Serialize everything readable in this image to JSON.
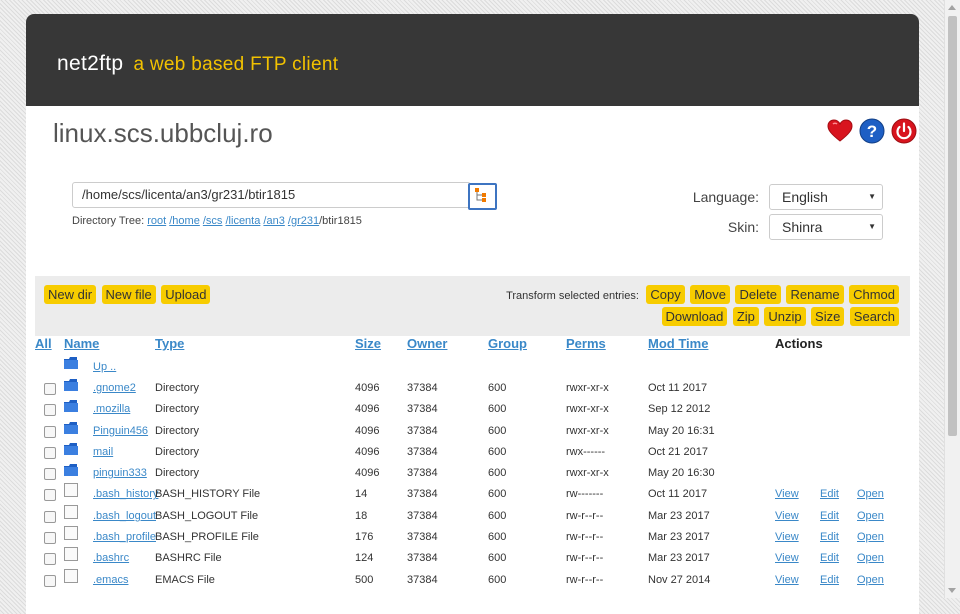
{
  "brand": {
    "name": "net2ftp",
    "tagline": "a web based FTP client"
  },
  "host": "linux.scs.ubbcluj.ro",
  "header_icons": [
    "heart-icon",
    "help-icon",
    "power-icon"
  ],
  "path": {
    "value": "/home/scs/licenta/an3/gr231/btir1815"
  },
  "dirtree": {
    "label": "Directory Tree:",
    "crumbs": [
      "root",
      "/home",
      "/scs",
      "/licenta",
      "/an3",
      "/gr231"
    ],
    "current": "/btir1815"
  },
  "settings": {
    "language_label": "Language:",
    "language_value": "English",
    "skin_label": "Skin:",
    "skin_value": "Shinra"
  },
  "toolbar": {
    "left": [
      "New dir",
      "New file",
      "Upload"
    ],
    "transform_label": "Transform selected entries:",
    "right_row1": [
      "Copy",
      "Move",
      "Delete",
      "Rename",
      "Chmod"
    ],
    "right_row2": [
      "Download",
      "Zip",
      "Unzip",
      "Size",
      "Search"
    ]
  },
  "columns": {
    "all": "All",
    "name": "Name",
    "type": "Type",
    "size": "Size",
    "owner": "Owner",
    "group": "Group",
    "perms": "Perms",
    "mtime": "Mod Time",
    "actions": "Actions"
  },
  "up_label": "Up ..",
  "actions": {
    "view": "View",
    "edit": "Edit",
    "open": "Open"
  },
  "files": [
    {
      "name": ".gnome2",
      "type": "Directory",
      "size": "4096",
      "owner": "37384",
      "group": "600",
      "perms": "rwxr-xr-x",
      "mtime": "Oct 11 2017",
      "kind": "folder"
    },
    {
      "name": ".mozilla",
      "type": "Directory",
      "size": "4096",
      "owner": "37384",
      "group": "600",
      "perms": "rwxr-xr-x",
      "mtime": "Sep 12 2012",
      "kind": "folder"
    },
    {
      "name": "Pinguin456",
      "type": "Directory",
      "size": "4096",
      "owner": "37384",
      "group": "600",
      "perms": "rwxr-xr-x",
      "mtime": "May 20 16:31",
      "kind": "folder"
    },
    {
      "name": "mail",
      "type": "Directory",
      "size": "4096",
      "owner": "37384",
      "group": "600",
      "perms": "rwx------",
      "mtime": "Oct 21 2017",
      "kind": "folder"
    },
    {
      "name": "pinguin333",
      "type": "Directory",
      "size": "4096",
      "owner": "37384",
      "group": "600",
      "perms": "rwxr-xr-x",
      "mtime": "May 20 16:30",
      "kind": "folder"
    },
    {
      "name": ".bash_history",
      "type": "BASH_HISTORY File",
      "size": "14",
      "owner": "37384",
      "group": "600",
      "perms": "rw-------",
      "mtime": "Oct 11 2017",
      "kind": "file"
    },
    {
      "name": ".bash_logout",
      "type": "BASH_LOGOUT File",
      "size": "18",
      "owner": "37384",
      "group": "600",
      "perms": "rw-r--r--",
      "mtime": "Mar 23 2017",
      "kind": "file"
    },
    {
      "name": ".bash_profile",
      "type": "BASH_PROFILE File",
      "size": "176",
      "owner": "37384",
      "group": "600",
      "perms": "rw-r--r--",
      "mtime": "Mar 23 2017",
      "kind": "file"
    },
    {
      "name": ".bashrc",
      "type": "BASHRC File",
      "size": "124",
      "owner": "37384",
      "group": "600",
      "perms": "rw-r--r--",
      "mtime": "Mar 23 2017",
      "kind": "file"
    },
    {
      "name": ".emacs",
      "type": "EMACS File",
      "size": "500",
      "owner": "37384",
      "group": "600",
      "perms": "rw-r--r--",
      "mtime": "Nov 27 2014",
      "kind": "file"
    }
  ]
}
